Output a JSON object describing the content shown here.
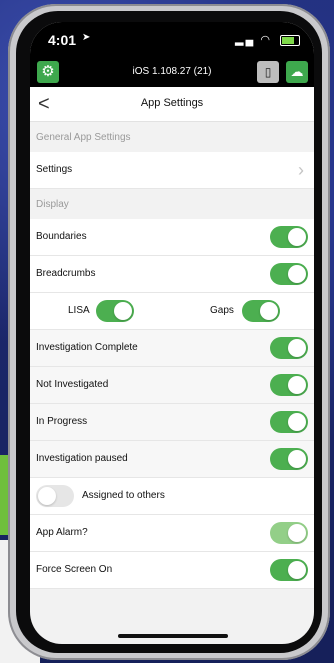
{
  "status_bar": {
    "time": "4:01"
  },
  "app_bar": {
    "version": "iOS 1.108.27 (21)"
  },
  "nav": {
    "title": "App Settings",
    "back_glyph": "<"
  },
  "sections": {
    "general": "General App Settings",
    "display": "Display"
  },
  "general_rows": {
    "settings": "Settings"
  },
  "display_rows": {
    "boundaries": {
      "label": "Boundaries",
      "on": true
    },
    "breadcrumbs": {
      "label": "Breadcrumbs",
      "on": true
    },
    "lisa": {
      "label": "LISA",
      "on": true
    },
    "gaps": {
      "label": "Gaps",
      "on": true
    },
    "investigation_complete": {
      "label": "Investigation Complete",
      "on": true
    },
    "not_investigated": {
      "label": "Not Investigated",
      "on": true
    },
    "in_progress": {
      "label": "In Progress",
      "on": true
    },
    "investigation_paused": {
      "label": "Investigation paused",
      "on": true
    },
    "assigned_to_others": {
      "label": "Assigned to others",
      "on": false
    },
    "app_alarm": {
      "label": "App Alarm?",
      "on": true
    },
    "force_screen_on": {
      "label": "Force Screen On",
      "on": true
    }
  },
  "colors": {
    "toggle_on": "#4caf50",
    "toggle_on_light": "#93cf88",
    "toggle_off": "#e6e6e6",
    "app_green": "#3ea84d"
  }
}
